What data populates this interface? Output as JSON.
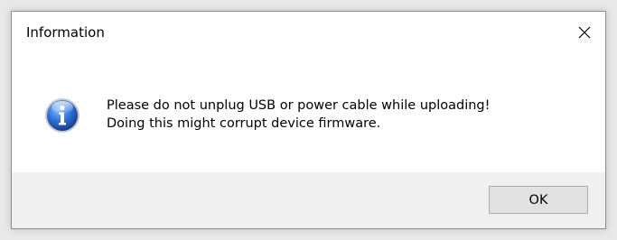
{
  "dialog": {
    "title": "Information",
    "close_icon": "close-icon",
    "icon": "info-icon",
    "message_line1": "Please do not unplug USB or power cable while uploading!",
    "message_line2": "Doing this might corrupt device firmware.",
    "ok_label": "OK"
  },
  "colors": {
    "window_bg": "#ffffff",
    "footer_bg": "#f0f0f0",
    "button_bg": "#e1e1e1",
    "button_border": "#adadad",
    "info_icon_blue": "#1f5fc9"
  }
}
